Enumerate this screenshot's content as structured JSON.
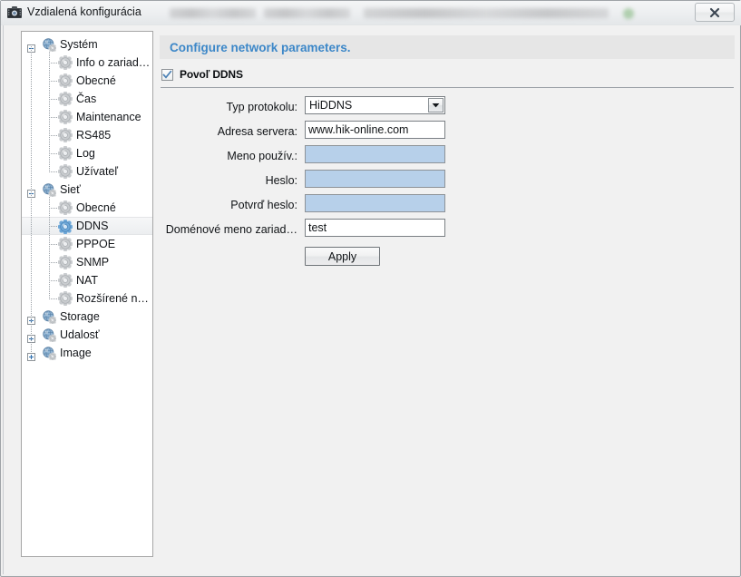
{
  "window": {
    "title": "Vzdialená konfigurácia",
    "icon": "camera-icon",
    "close_label": "×",
    "redacted_text": ""
  },
  "tree": {
    "nodes": [
      {
        "label": "Systém",
        "level": 0,
        "icon": "globe-icon",
        "expander": "minus",
        "selected": false
      },
      {
        "label": "Info o zariad…",
        "level": 1,
        "icon": "gear-icon",
        "expander": "none",
        "selected": false
      },
      {
        "label": "Obecné",
        "level": 1,
        "icon": "gear-icon",
        "expander": "none",
        "selected": false
      },
      {
        "label": "Čas",
        "level": 1,
        "icon": "gear-icon",
        "expander": "none",
        "selected": false
      },
      {
        "label": "Maintenance",
        "level": 1,
        "icon": "gear-icon",
        "expander": "none",
        "selected": false
      },
      {
        "label": "RS485",
        "level": 1,
        "icon": "gear-icon",
        "expander": "none",
        "selected": false
      },
      {
        "label": "Log",
        "level": 1,
        "icon": "gear-icon",
        "expander": "none",
        "selected": false
      },
      {
        "label": "Užívateľ",
        "level": 1,
        "icon": "gear-icon",
        "expander": "none",
        "selected": false
      },
      {
        "label": "Sieť",
        "level": 0,
        "icon": "globe-icon",
        "expander": "minus",
        "selected": false
      },
      {
        "label": "Obecné",
        "level": 1,
        "icon": "gear-icon",
        "expander": "none",
        "selected": false
      },
      {
        "label": "DDNS",
        "level": 1,
        "icon": "gear-icon-blue",
        "expander": "none",
        "selected": true
      },
      {
        "label": "PPPOE",
        "level": 1,
        "icon": "gear-icon",
        "expander": "none",
        "selected": false
      },
      {
        "label": "SNMP",
        "level": 1,
        "icon": "gear-icon",
        "expander": "none",
        "selected": false
      },
      {
        "label": "NAT",
        "level": 1,
        "icon": "gear-icon",
        "expander": "none",
        "selected": false
      },
      {
        "label": "Rozšírené n…",
        "level": 1,
        "icon": "gear-icon",
        "expander": "none",
        "selected": false
      },
      {
        "label": "Storage",
        "level": 0,
        "icon": "globe-icon",
        "expander": "plus",
        "selected": false
      },
      {
        "label": "Udalosť",
        "level": 0,
        "icon": "globe-icon",
        "expander": "plus",
        "selected": false
      },
      {
        "label": "Image",
        "level": 0,
        "icon": "globe-icon",
        "expander": "plus",
        "selected": false
      }
    ]
  },
  "panel": {
    "header": "Configure network parameters.",
    "enable": {
      "label": "Povoľ DDNS",
      "checked": true
    },
    "fields": [
      {
        "label": "Typ protokolu:",
        "value": "HiDDNS",
        "type": "select",
        "disabled": false,
        "placeholder": ""
      },
      {
        "label": "Adresa servera:",
        "value": "www.hik-online.com",
        "type": "text",
        "disabled": false,
        "placeholder": ""
      },
      {
        "label": "Meno použív.:",
        "value": "",
        "type": "text",
        "disabled": true,
        "placeholder": ""
      },
      {
        "label": "Heslo:",
        "value": "",
        "type": "password",
        "disabled": true,
        "placeholder": ""
      },
      {
        "label": "Potvrď heslo:",
        "value": "",
        "type": "password",
        "disabled": true,
        "placeholder": ""
      },
      {
        "label": "Doménové meno zariad…",
        "value": "test",
        "type": "text",
        "disabled": false,
        "placeholder": ""
      }
    ],
    "apply_label": "Apply"
  },
  "colors": {
    "accent": "#3c87c8",
    "header_bg": "#e6e6e6",
    "disabled_field": "#b7d0ea",
    "window_bg": "#f1f1f1"
  }
}
